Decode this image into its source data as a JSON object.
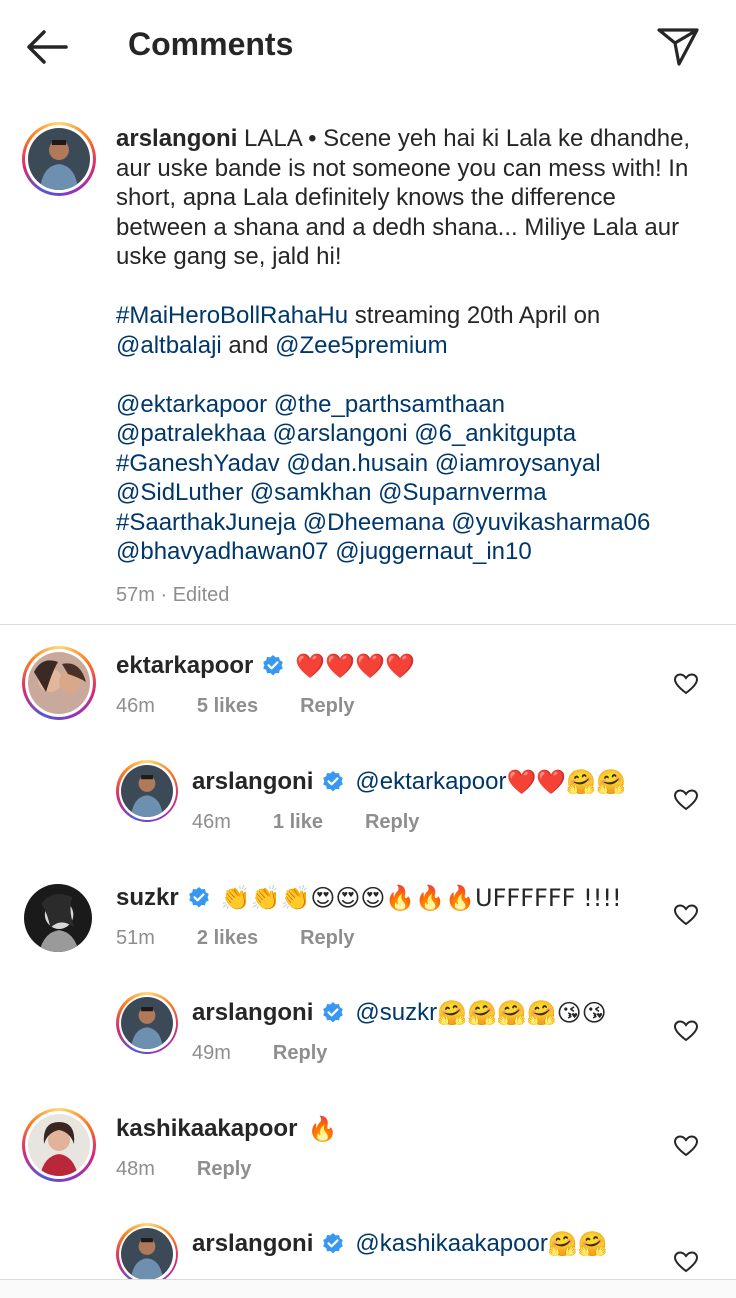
{
  "header": {
    "title": "Comments"
  },
  "post": {
    "username": "arslangoni",
    "caption_text": "LALA • Scene yeh hai ki Lala ke dhandhe, aur uske bande is not someone you can mess with! In short, apna Lala definitely knows the difference between a shana and a dedh shana... Miliye Lala aur uske gang se, jald hi!",
    "hashtag_main": "#MaiHeroBollRahaHu",
    "stream_text": " streaming 20th April on",
    "mention_altbalaji": "@altbalaji",
    "and_text": " and ",
    "mention_zee5": "@Zee5premium",
    "tags_line1": "@ektarkapoor @the_parthsamthaan",
    "tags_line2": "@patralekhaa @arslangoni @6_ankitgupta",
    "tags_line3": "#GaneshYadav @dan.husain @iamroysanyal",
    "tags_line4": "@SidLuther @samkhan @Suparnverma",
    "tags_line5": "#SaarthakJuneja @Dheemana @yuvikasharma06",
    "tags_line6": "@bhavyadhawan07 @juggernaut_in10",
    "time": "57m",
    "separator": "·",
    "edited": "Edited"
  },
  "comments": [
    {
      "username": "ektarkapoor",
      "text": "❤️❤️❤️❤️",
      "time": "46m",
      "likes": "5 likes",
      "reply": "Reply",
      "verified": true
    },
    {
      "username": "arslangoni",
      "mention": "@ektarkapoor",
      "text": " ❤️❤️🤗🤗",
      "time": "46m",
      "likes": "1 like",
      "reply": "Reply",
      "verified": true
    },
    {
      "username": "suzkr",
      "text": "👏👏👏😍😍😍🔥🔥🔥UFFFFFF !!!!",
      "time": "51m",
      "likes": "2 likes",
      "reply": "Reply",
      "verified": true
    },
    {
      "username": "arslangoni",
      "mention": "@suzkr",
      "text": " 🤗🤗🤗🤗😘😘",
      "time": "49m",
      "reply": "Reply",
      "verified": true
    },
    {
      "username": "kashikaakapoor",
      "text": "🔥",
      "time": "48m",
      "reply": "Reply",
      "verified": false
    },
    {
      "username": "arslangoni",
      "mention": "@kashikaakapoor",
      "text": " 🤗🤗",
      "verified": true
    }
  ],
  "colors": {
    "verified": "#3897f0",
    "link": "#00376b",
    "secondary": "#8e8e8e"
  },
  "icons": [
    "back-arrow-icon",
    "send-icon",
    "verified-icon",
    "heart-icon"
  ]
}
